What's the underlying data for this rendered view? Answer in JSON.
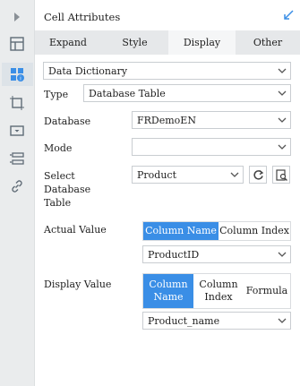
{
  "panel": {
    "title": "Cell Attributes",
    "tabs": [
      {
        "label": "Expand",
        "active": false
      },
      {
        "label": "Style",
        "active": false
      },
      {
        "label": "Display",
        "active": true
      },
      {
        "label": "Other",
        "active": false
      }
    ]
  },
  "sidebar_icons": [
    "cell-element-icon",
    "cell-attribute-icon",
    "float-element-icon",
    "widget-settings-icon",
    "condition-attribute-icon",
    "hyperlink-icon"
  ],
  "display": {
    "dictionary_type": "Data Dictionary",
    "type_label": "Type",
    "type_value": "Database Table",
    "database_label": "Database",
    "database_value": "FRDemoEN",
    "mode_label": "Mode",
    "mode_value": "",
    "select_table_label": [
      "Select",
      "Database",
      "Table"
    ],
    "select_table_value": "Product",
    "actual_value_label": "Actual Value",
    "actual_value_options": [
      "Column Name",
      "Column Index"
    ],
    "actual_value_selected": "ProductID",
    "display_value_label": "Display Value",
    "display_value_options": [
      [
        "Column",
        "Name"
      ],
      [
        "Column",
        "Index"
      ],
      [
        "Formula"
      ]
    ],
    "display_value_selected": "Product_name"
  },
  "colors": {
    "accent": "#3a8ee6",
    "sidebar_bg": "#eaeced"
  }
}
